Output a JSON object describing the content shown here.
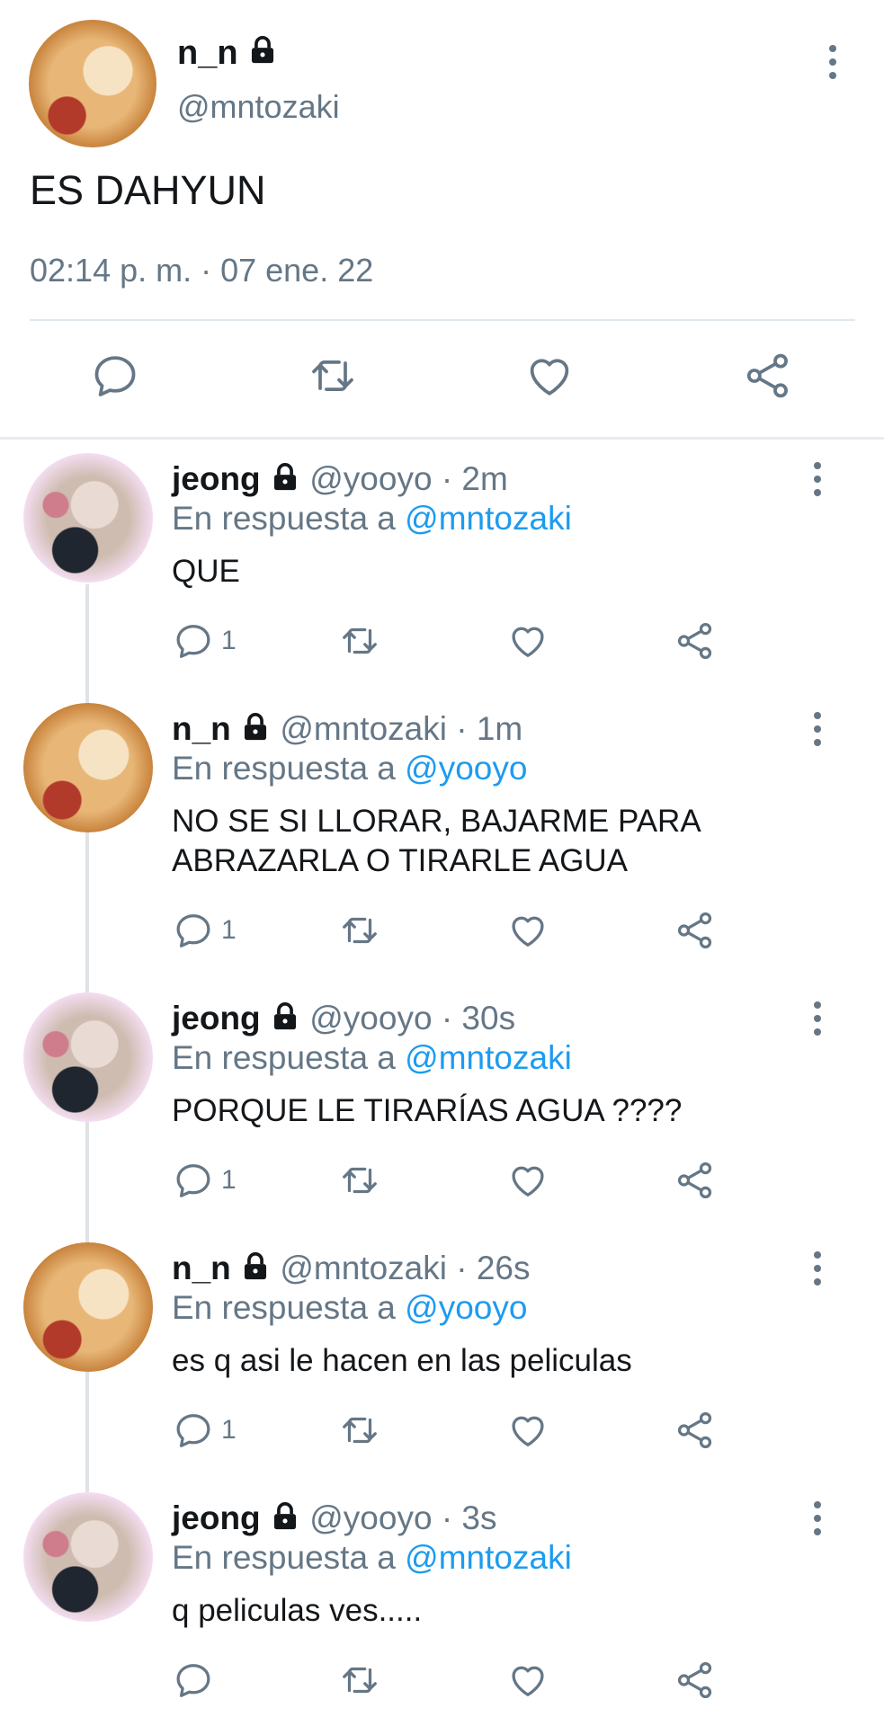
{
  "main_tweet": {
    "name": "n_n",
    "handle": "@mntozaki",
    "text": "ES DAHYUN",
    "timestamp": "02:14 p. m. · 07 ene. 22",
    "avatar_icon": "anime-blonde-avatar",
    "lock_icon": "lock-icon"
  },
  "replies": [
    {
      "name": "jeong",
      "handle": "@yooyo",
      "time": "2m",
      "in_reply_prefix": "En respuesta a",
      "in_reply_to": "@mntozaki",
      "text": "QUE",
      "reply_count": "1"
    },
    {
      "name": "n_n",
      "handle": "@mntozaki",
      "time": "1m",
      "in_reply_prefix": "En respuesta a",
      "in_reply_to": "@yooyo",
      "text": "NO SE SI LLORAR, BAJARME PARA\nABRAZARLA O TIRARLE AGUA",
      "reply_count": "1"
    },
    {
      "name": "jeong",
      "handle": "@yooyo",
      "time": "30s",
      "in_reply_prefix": "En respuesta a",
      "in_reply_to": "@mntozaki",
      "text": "PORQUE LE TIRARÍAS AGUA ????",
      "reply_count": "1"
    },
    {
      "name": "n_n",
      "handle": "@mntozaki",
      "time": "26s",
      "in_reply_prefix": "En respuesta a",
      "in_reply_to": "@yooyo",
      "text": "es q asi le hacen en las peliculas",
      "reply_count": "1"
    },
    {
      "name": "jeong",
      "handle": "@yooyo",
      "time": "3s",
      "in_reply_prefix": "En respuesta a",
      "in_reply_to": "@mntozaki",
      "text": "q peliculas ves.....",
      "reply_count": ""
    }
  ],
  "colors": {
    "link": "#1d9bf0",
    "muted": "#657786",
    "text": "#14171a"
  }
}
